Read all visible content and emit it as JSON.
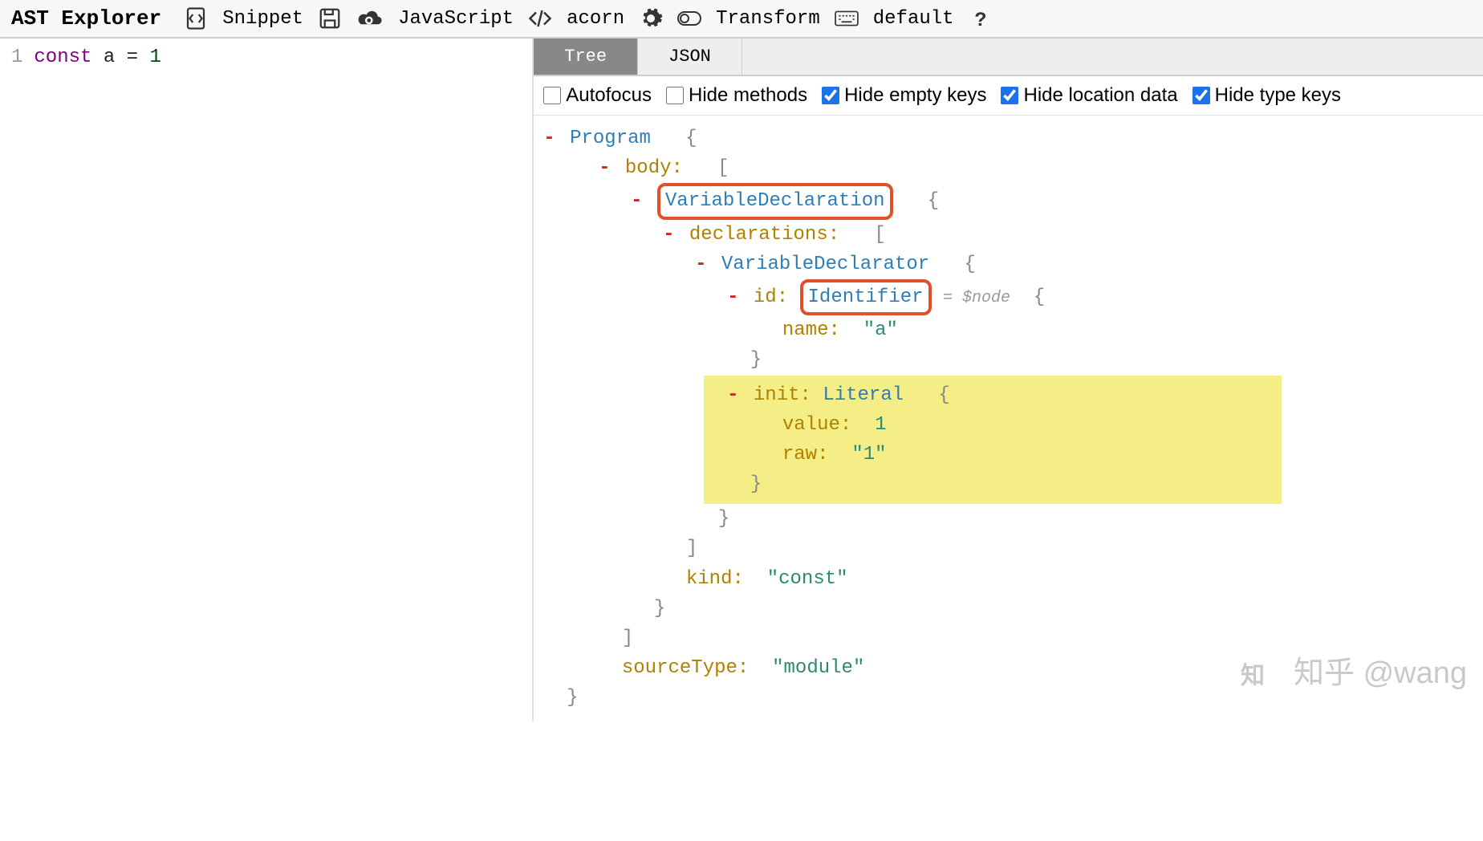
{
  "toolbar": {
    "title": "AST Explorer",
    "snippet_label": "Snippet",
    "language_label": "JavaScript",
    "parser_label": "acorn",
    "transform_label": "Transform",
    "preset_label": "default"
  },
  "editor": {
    "line_number": "1",
    "keyword": "const",
    "identifier": "a",
    "operator": "=",
    "value": "1"
  },
  "tabs": {
    "tree": "Tree",
    "json": "JSON"
  },
  "options": {
    "autofocus": {
      "label": "Autofocus",
      "checked": false
    },
    "hide_methods": {
      "label": "Hide methods",
      "checked": false
    },
    "hide_empty_keys": {
      "label": "Hide empty keys",
      "checked": true
    },
    "hide_location_data": {
      "label": "Hide location data",
      "checked": true
    },
    "hide_type_keys": {
      "label": "Hide type keys",
      "checked": true
    }
  },
  "tree": {
    "program": "Program",
    "body": "body",
    "variable_declaration": "VariableDeclaration",
    "declarations": "declarations",
    "variable_declarator": "VariableDeclarator",
    "id": "id",
    "identifier": "Identifier",
    "node_anno": "= $node",
    "name_key": "name",
    "name_val": "\"a\"",
    "init_key": "init",
    "literal": "Literal",
    "value_key": "value",
    "value_val": "1",
    "raw_key": "raw",
    "raw_val": "\"1\"",
    "kind_key": "kind",
    "kind_val": "\"const\"",
    "source_type_key": "sourceType",
    "source_type_val": "\"module\"",
    "open_brace": "{",
    "close_brace": "}",
    "open_bracket": "[",
    "close_bracket": "]",
    "colon": ":"
  },
  "watermark": {
    "text": "知乎 @wang"
  }
}
